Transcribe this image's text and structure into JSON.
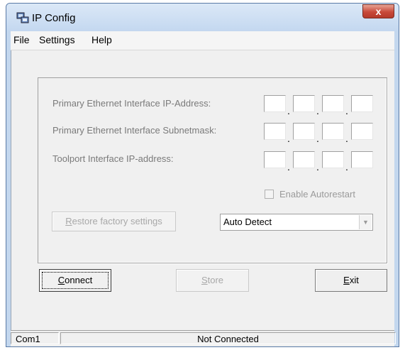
{
  "window": {
    "title": "IP Config",
    "close_glyph": "x"
  },
  "menu": {
    "items": [
      "File",
      "Settings",
      "Help"
    ]
  },
  "form": {
    "primary_ip_label": "Primary Ethernet Interface IP-Address:",
    "subnet_label": "Primary Ethernet Interface Subnetmask:",
    "toolport_label": "Toolport Interface IP-address:",
    "dot": ".",
    "enable_autorestart_label": "Enable Autorestart",
    "enable_autorestart_checked": false,
    "restore_button": {
      "mnemonic": "R",
      "rest": "estore factory settings"
    },
    "detect_select": {
      "value": "Auto Detect"
    }
  },
  "buttons": {
    "connect": {
      "mnemonic": "C",
      "rest": "onnect"
    },
    "store": {
      "mnemonic": "S",
      "rest": "tore"
    },
    "exit": {
      "mnemonic": "E",
      "rest": "xit"
    }
  },
  "status": {
    "port": "Com1",
    "connection": "Not Connected"
  },
  "icons": {
    "app": "network-config-icon",
    "dropdown": "chevron-down-icon"
  }
}
